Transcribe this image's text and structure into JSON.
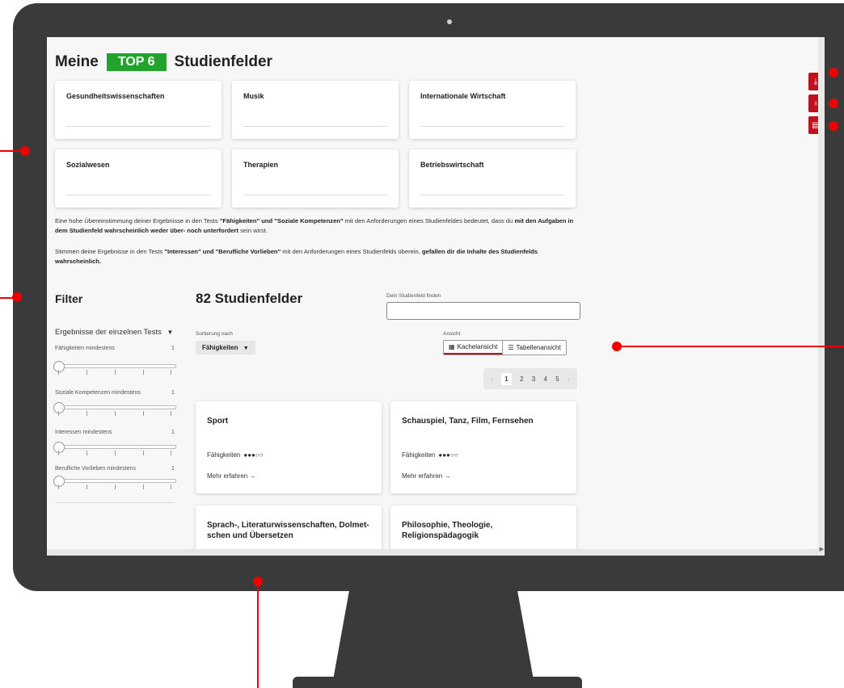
{
  "header": {
    "title_prefix": "Meine",
    "badge": "TOP 6",
    "title_suffix": "Studienfelder"
  },
  "top_fields": [
    "Gesundheitswissenschaften",
    "Musik",
    "Internationale Wirtschaft",
    "Sozialwesen",
    "Therapien",
    "Betriebswirtschaft"
  ],
  "info": {
    "p1_a": "Eine hohe Übereinstimmung deiner Ergebnisse in den Tests ",
    "p1_b": "\"Fähigkeiten\" und \"Soziale Kompetenzen\"",
    "p1_c": " mit den Anforderungen eines Studienfeldes bedeutet, dass du ",
    "p1_d": "mit den Aufgaben in dem Studienfeld wahrscheinlich weder über- noch unterfordert",
    "p1_e": " sein wirst.",
    "p2_a": "Stimmen deine Ergebnisse in den Tests ",
    "p2_b": "\"Interessen\" und \"Berufliche Vorlieben\"",
    "p2_c": " mit den Anforderungen eines Studienfelds überein, ",
    "p2_d": "gefallen dir die Inhalte des Studienfelds wahrscheinlich."
  },
  "filter": {
    "title": "Filter",
    "group": "Ergebnisse der einzelnen Tests",
    "sliders": [
      {
        "label": "Fähigkeiten mindestens",
        "value": "1"
      },
      {
        "label": "Soziale Kompetenzen mindestens",
        "value": "1"
      },
      {
        "label": "Interessen mindestens",
        "value": "1"
      },
      {
        "label": "Berufliche Vorlieben mindestens",
        "value": "1"
      }
    ]
  },
  "results": {
    "count_title": "82 Studienfelder",
    "search_label": "Dein Studienfeld finden",
    "search_value": "",
    "sort_label": "Sortierung nach",
    "sort_value": "Fähigkeiten",
    "view_label": "Ansicht",
    "view_tiles": "Kachelansicht",
    "view_table": "Tabellenansicht",
    "pages": [
      "1",
      "2",
      "3",
      "4",
      "5"
    ],
    "prev": "‹",
    "next": "›",
    "cards": [
      {
        "name": "Sport",
        "metric": "Fähigkeiten",
        "dots": "●●●○○",
        "more": "Mehr erfahren →"
      },
      {
        "name": "Schauspiel, Tanz, Film, Fernsehen",
        "metric": "Fähigkeiten",
        "dots": "●●●○○",
        "more": "Mehr erfahren →"
      },
      {
        "name": "Sprach-, Literaturwissenschaften, Dolmet-schen und Übersetzen",
        "metric": "",
        "dots": "",
        "more": ""
      },
      {
        "name": "Philosophie, Theologie, Religionspädagogik",
        "metric": "",
        "dots": "",
        "more": ""
      }
    ]
  },
  "side_actions": [
    {
      "icon": "download-icon",
      "glyph": "⤓"
    },
    {
      "icon": "award-icon",
      "glyph": "♁"
    },
    {
      "icon": "document-icon",
      "glyph": "▤"
    }
  ],
  "colors": {
    "accent": "#c0121e",
    "badge": "#22a32c",
    "marker": "#ee0000",
    "frame": "#3a3a3a"
  }
}
